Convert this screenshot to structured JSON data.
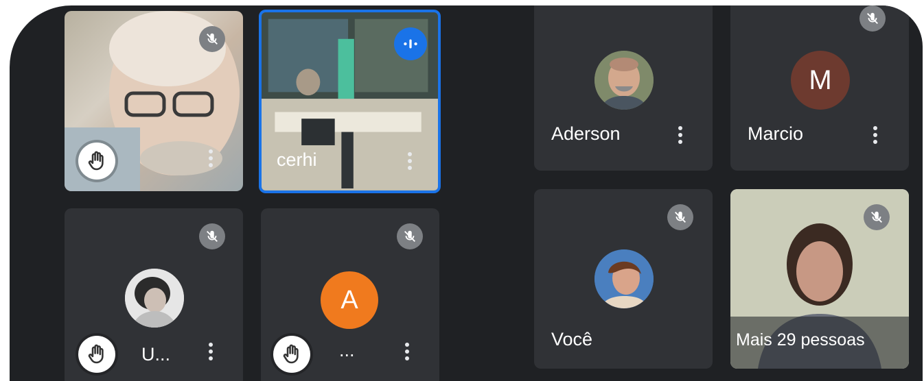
{
  "participants": {
    "p1": {
      "name": ""
    },
    "p2": {
      "name": "cerhi"
    },
    "p3": {
      "name": "U..."
    },
    "p4": {
      "name": "...",
      "initial": "A"
    },
    "aderson": {
      "name": "Aderson"
    },
    "marcio": {
      "name": "Marcio",
      "initial": "M"
    },
    "voce": {
      "name": "Você"
    },
    "more": {
      "label": "Mais 29 pessoas"
    }
  },
  "colors": {
    "background": "#1f2124",
    "tile": "#3c4043",
    "speaking_border": "#1a73e8",
    "avatar_a": "#f07a1e",
    "avatar_m": "#6d3a2f"
  },
  "icons": [
    "mic-off-icon",
    "raised-hand-icon",
    "more-options-icon",
    "speaking-indicator-icon"
  ]
}
